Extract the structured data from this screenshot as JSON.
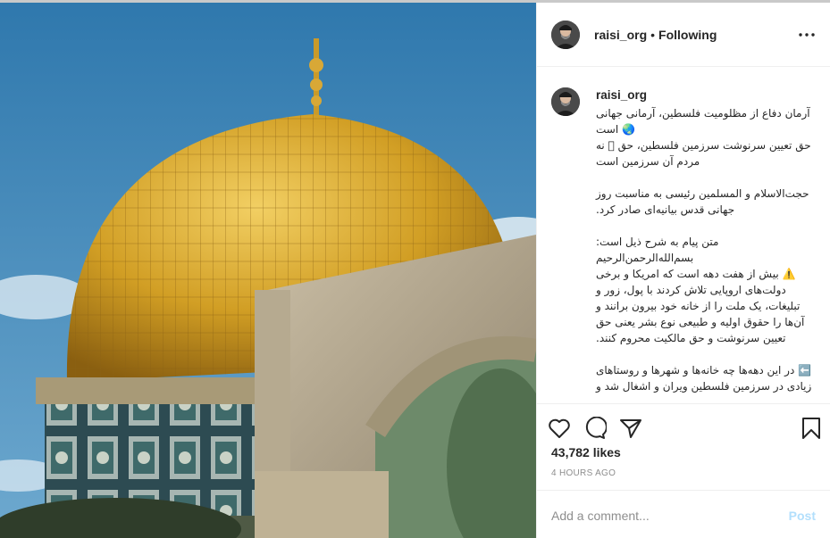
{
  "post": {
    "username": "raisi_org",
    "separator": "•",
    "follow_status": "Following",
    "more_label": "•••",
    "caption_user": "raisi_org",
    "caption_text": "آرمان دفاع از مظلومیت فلسطین، آرمانی جهانی🌏 است\nحق تعیین سرنوشت سرزمین فلسطین، حق 🏻 نه مردم آن سرزمین است\n\nحجت‌الاسلام و المسلمین رئیسی به مناسبت روز جهانی قدس بیانیه‌ای صادر کرد.\n\nمتن پیام به شرح ذیل است:\nبسم‌الله‌الرحمن‌الرحیم\n⚠️ بیش از هفت دهه است که امریکا و برخی دولت‌های اروپایی تلاش کردند با پول، زور و تبلیغات، یک ملت را از خانه خود بیرون برانند و آن‌ها را حقوق اولیه و طبیعی نوع بشر یعنی حق تعیین سرنوشت و حق مالکیت محروم کنند.\n\n⬅️ در این دهه‌ها چه خانه‌ها و شهرها و روستاهای زیادی در سرزمین فلسطین ویران و اشغال شد و",
    "likes": "43,782 likes",
    "time_ago": "4 HOURS AGO",
    "comment_placeholder": "Add a comment...",
    "post_label": "Post"
  },
  "icons": {
    "like": "heart-icon",
    "comment": "comment-icon",
    "share": "share-icon",
    "save": "bookmark-icon",
    "more": "more-icon"
  },
  "colors": {
    "text": "#262626",
    "muted": "#8e8e8e",
    "post_disabled": "#b2dffc",
    "dome_gold": "#d4a52a",
    "sky": "#3e86b8"
  }
}
